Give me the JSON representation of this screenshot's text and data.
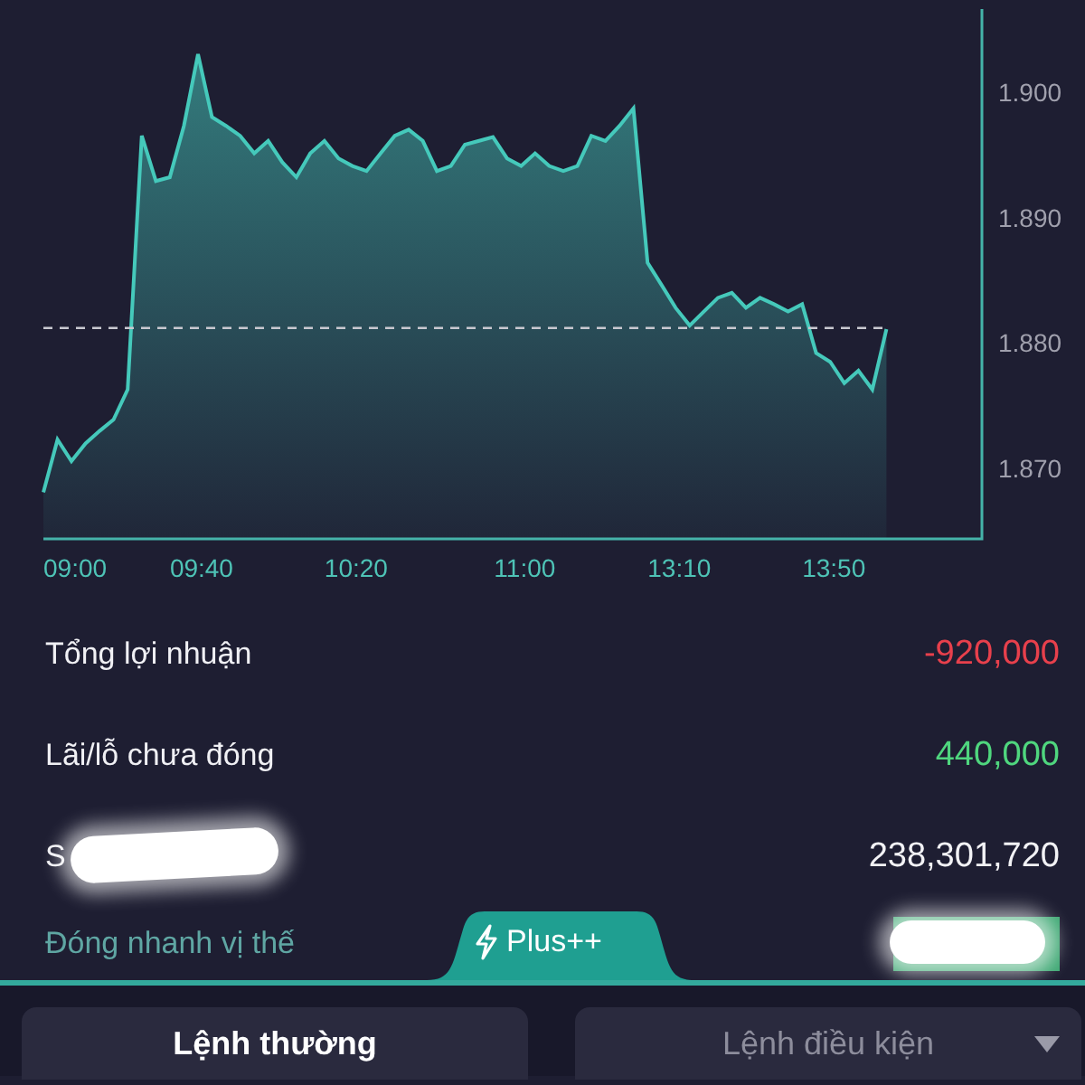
{
  "chart": {
    "chart_data": {
      "type": "area",
      "ylim": [
        1.8644,
        1.9066
      ],
      "categories": [
        null,
        null,
        "09:00",
        null,
        null,
        null,
        null,
        null,
        null,
        null,
        null,
        "09:40",
        null,
        null,
        null,
        null,
        null,
        null,
        null,
        null,
        null,
        null,
        "10:20",
        null,
        null,
        null,
        null,
        null,
        null,
        null,
        null,
        null,
        null,
        null,
        "11:00",
        null,
        null,
        null,
        null,
        null,
        null,
        null,
        null,
        null,
        null,
        "13:10",
        null,
        null,
        null,
        null,
        null,
        null,
        null,
        null,
        null,
        null,
        "13:50",
        null,
        null,
        null,
        null
      ],
      "yticks": [
        {
          "value": 1.87,
          "label": "1.870"
        },
        {
          "value": 1.88,
          "label": "1.880"
        },
        {
          "value": 1.89,
          "label": "1.890"
        },
        {
          "value": 1.9,
          "label": "1.900"
        }
      ],
      "series": [
        {
          "color": "#45c9bb",
          "values": [
            1.8681,
            1.8723,
            1.8706,
            1.872,
            1.873,
            1.8739,
            1.8763,
            1.8965,
            1.8929,
            1.8932,
            1.8973,
            1.903,
            1.898,
            1.8973,
            1.8965,
            1.8951,
            1.8961,
            1.8944,
            1.8932,
            1.8951,
            1.8961,
            1.8947,
            1.8941,
            1.8937,
            1.8951,
            1.8965,
            1.897,
            1.8961,
            1.8937,
            1.8941,
            1.8958,
            1.8961,
            1.8964,
            1.8947,
            1.8941,
            1.8951,
            1.8941,
            1.8937,
            1.8941,
            1.8965,
            1.8961,
            1.8973,
            1.8987,
            1.8864,
            1.8846,
            1.8828,
            1.8814,
            1.8825,
            1.8836,
            1.884,
            1.8828,
            1.8836,
            1.8831,
            1.8825,
            1.8831,
            1.8792,
            1.8785,
            1.8768,
            1.8778,
            1.8763,
            1.8811
          ]
        }
      ],
      "ref_lines": [
        {
          "axis": "y",
          "value": 1.8812
        }
      ]
    }
  },
  "rows": [
    {
      "label": "Tổng lợi nhuận",
      "value": "-920,000",
      "color": "#e8404c",
      "redacted": false
    },
    {
      "label": "Lãi/lỗ chưa đóng",
      "value": "440,000",
      "color": "#4fd67e",
      "redacted": false
    },
    {
      "label": "S",
      "value": "238,301,720",
      "color": "#f2f2f5",
      "redacted": true
    }
  ],
  "quick_close_link": "Đóng nhanh vị thế",
  "plus_tab": {
    "label": "Plus++"
  },
  "quick_button": {
    "redacted": true
  },
  "order_tabs": [
    {
      "label": "Lệnh thường",
      "selected": true,
      "dropdown": false
    },
    {
      "label": "Lệnh điều kiện",
      "selected": false,
      "dropdown": true
    }
  ]
}
